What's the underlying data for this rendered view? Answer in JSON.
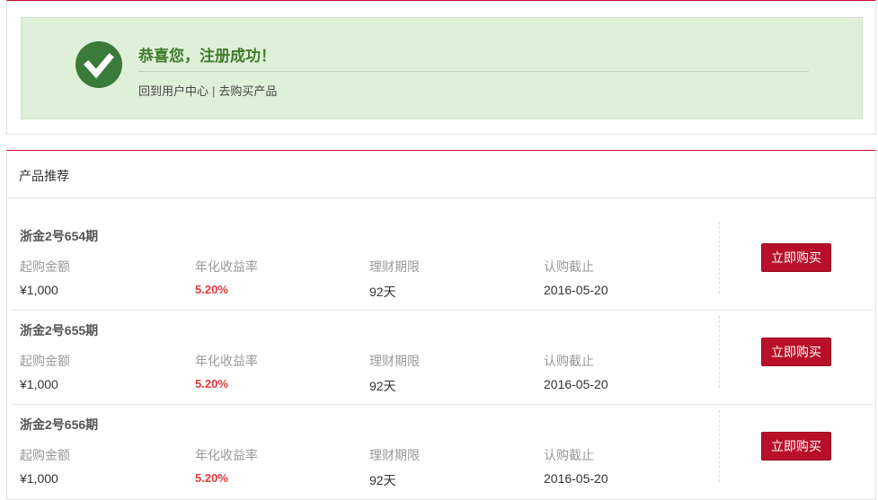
{
  "success": {
    "title": "恭喜您，注册成功！",
    "link_user_center": "回到用户中心",
    "separator": "|",
    "link_buy": "去购买产品",
    "icon": "check-circle-icon",
    "accent_color": "#3a7a3a"
  },
  "recommend": {
    "title": "产品推荐",
    "labels": {
      "min_amount": "起购金额",
      "annual_rate": "年化收益率",
      "term": "理财期限",
      "deadline": "认购截止"
    },
    "buy_label": "立即购买",
    "products": [
      {
        "name": "浙金2号654期",
        "min_amount": "¥1,000",
        "annual_rate": "5.20%",
        "term": "92天",
        "deadline": "2016-05-20"
      },
      {
        "name": "浙金2号655期",
        "min_amount": "¥1,000",
        "annual_rate": "5.20%",
        "term": "92天",
        "deadline": "2016-05-20"
      },
      {
        "name": "浙金2号656期",
        "min_amount": "¥1,000",
        "annual_rate": "5.20%",
        "term": "92天",
        "deadline": "2016-05-20"
      }
    ]
  },
  "colors": {
    "brand_red": "#b8102a",
    "rate_red": "#e4393c",
    "success_bg": "#dff0d8"
  }
}
